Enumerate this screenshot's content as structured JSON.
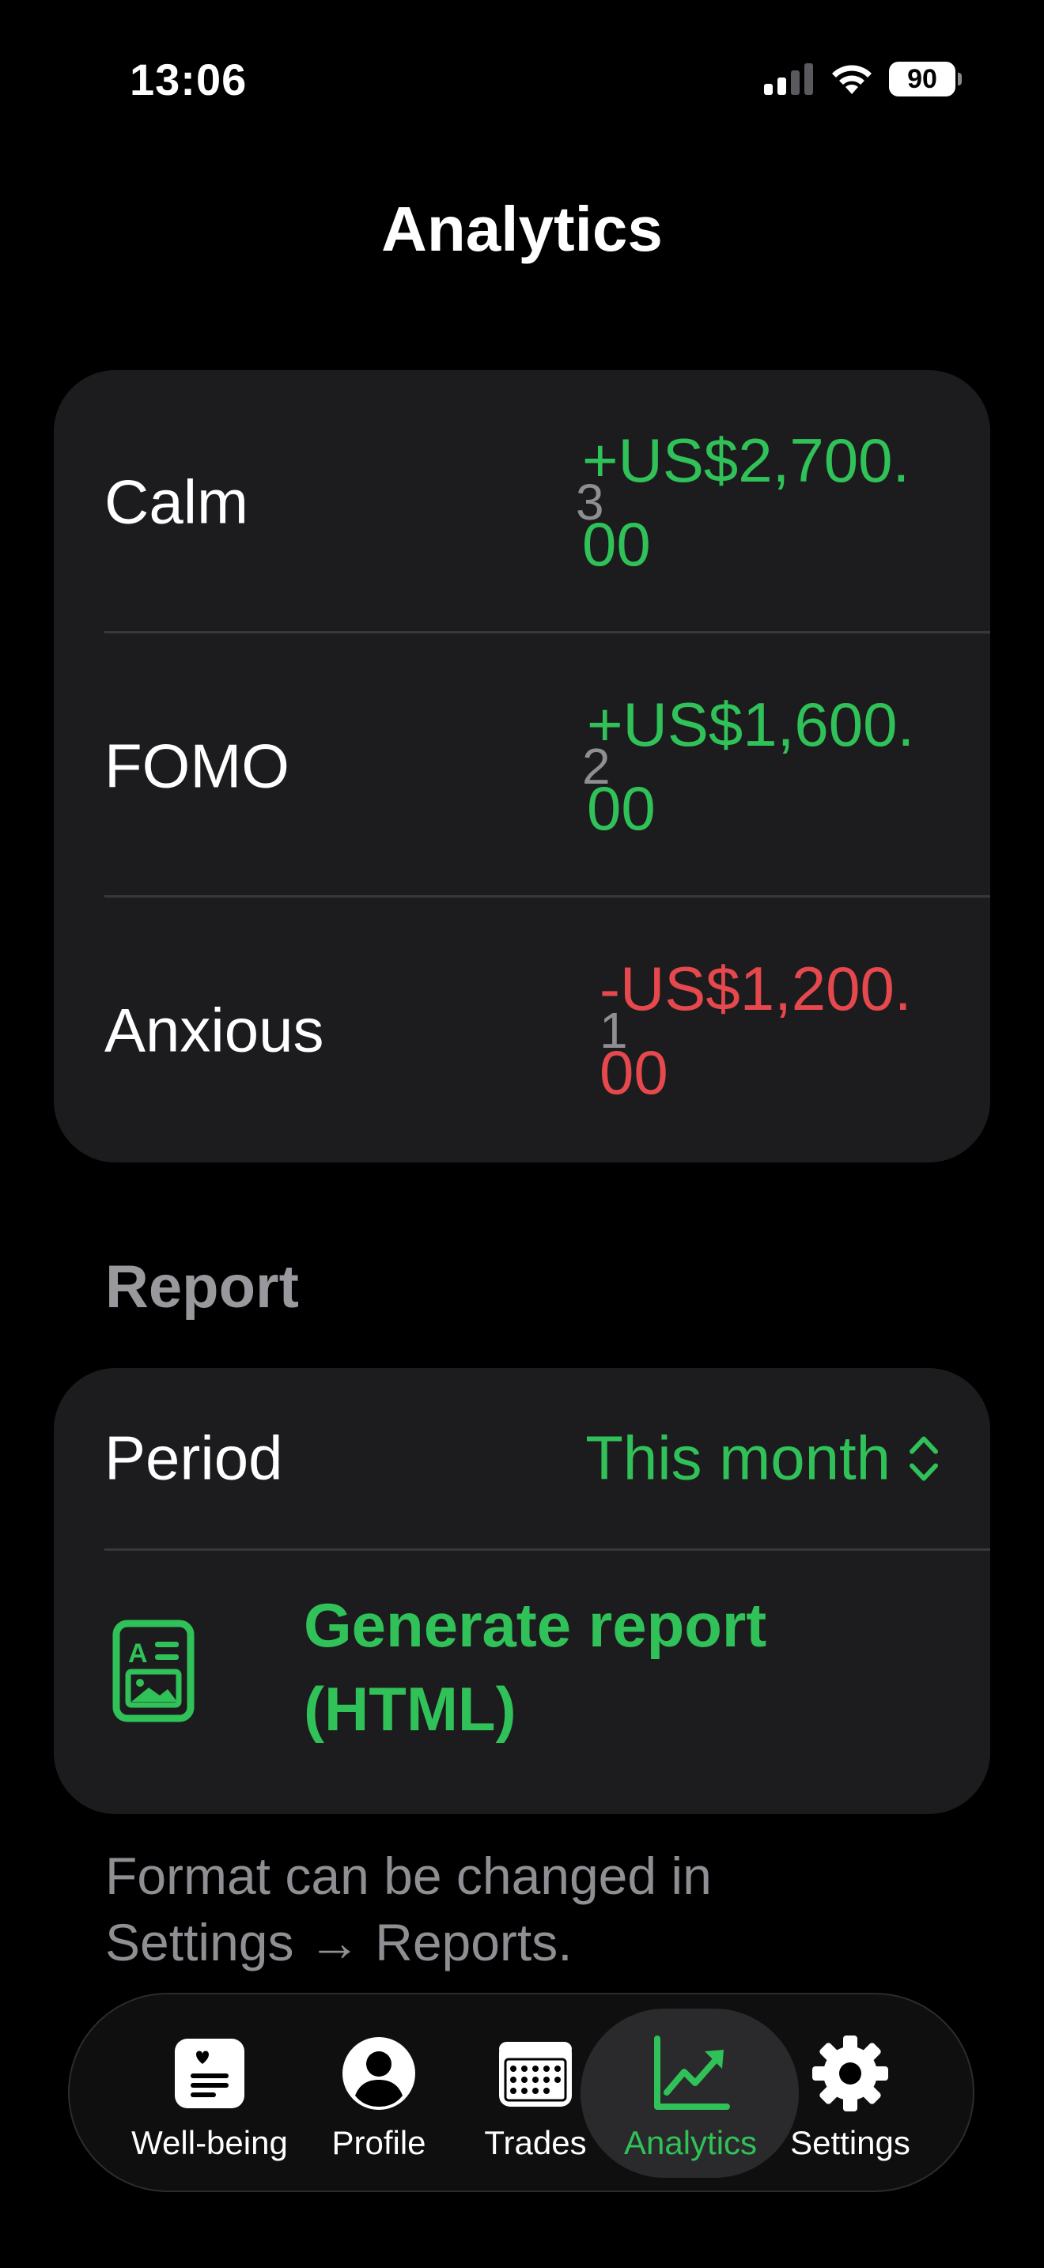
{
  "status_bar": {
    "time": "13:06",
    "battery": "90"
  },
  "page": {
    "title": "Analytics"
  },
  "emotions": [
    {
      "name": "Calm",
      "count": "3",
      "amount_line1": "+US$2,700.",
      "amount_line2": "00",
      "color": "#30c158"
    },
    {
      "name": "FOMO",
      "count": "2",
      "amount_line1": "+US$1,600.",
      "amount_line2": "00",
      "color": "#30c158"
    },
    {
      "name": "Anxious",
      "count": "1",
      "amount_line1": "-US$1,200.",
      "amount_line2": "00",
      "color": "#e5484d"
    }
  ],
  "report": {
    "section_title": "Report",
    "period_label": "Period",
    "period_value": "This month",
    "generate_label": "Generate report (HTML)",
    "footnote": "Format can be changed in Settings → Reports."
  },
  "tabbar": {
    "tabs": [
      {
        "label": "Well-being",
        "icon": "wellbeing-icon"
      },
      {
        "label": "Profile",
        "icon": "profile-icon"
      },
      {
        "label": "Trades",
        "icon": "calendar-icon"
      },
      {
        "label": "Analytics",
        "icon": "chart-icon",
        "active": true
      },
      {
        "label": "Settings",
        "icon": "gear-icon"
      }
    ]
  },
  "colors": {
    "accent": "#30c158",
    "negative": "#e5484d",
    "card": "#1c1c1e",
    "secondary_text": "#8e8e93"
  }
}
